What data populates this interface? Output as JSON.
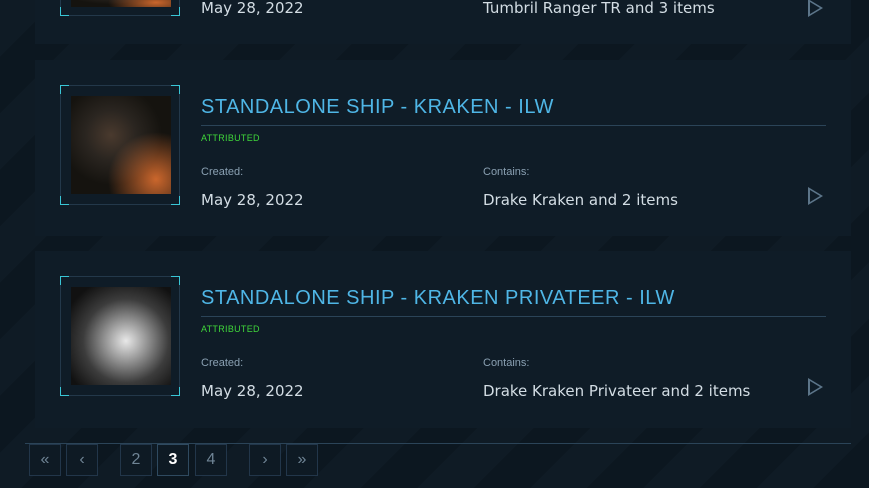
{
  "cards": [
    {
      "date": "May 28, 2022",
      "contains": "Tumbril Ranger TR and 3 items"
    },
    {
      "title": "STANDALONE SHIP - KRAKEN - ILW",
      "badge": "ATTRIBUTED",
      "created_label": "Created:",
      "date": "May 28, 2022",
      "contains_label": "Contains:",
      "contains": "Drake Kraken and 2 items"
    },
    {
      "title": "STANDALONE SHIP - KRAKEN PRIVATEER - ILW",
      "badge": "ATTRIBUTED",
      "created_label": "Created:",
      "date": "May 28, 2022",
      "contains_label": "Contains:",
      "contains": "Drake Kraken Privateer and 2 items"
    }
  ],
  "pagination": {
    "first": "«",
    "prev": "‹",
    "pages": [
      "2",
      "3",
      "4"
    ],
    "current": "3",
    "next": "›",
    "last": "»"
  },
  "colors": {
    "title": "#4fb6e6",
    "badge": "#3fd63a",
    "corner": "#39c6d6"
  }
}
